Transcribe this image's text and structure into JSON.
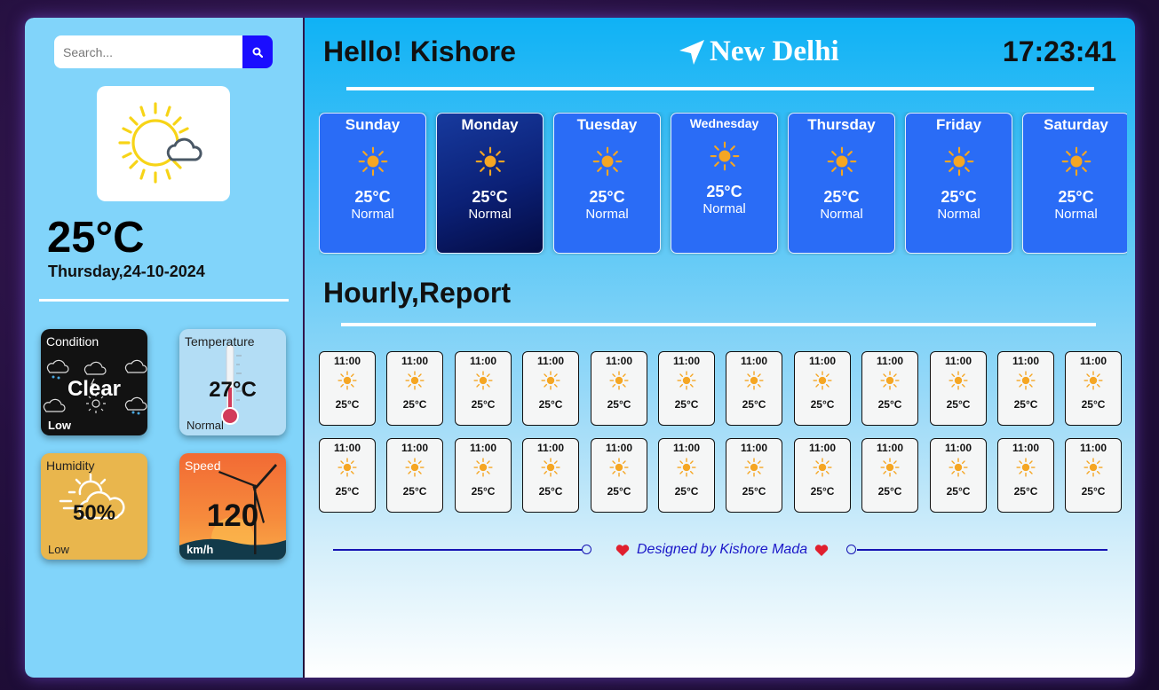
{
  "search": {
    "placeholder": "Search..."
  },
  "sidebar": {
    "temperature": "25°C",
    "date": "Thursday,24-10-2024",
    "tiles": {
      "condition": {
        "label": "Condition",
        "value": "Clear",
        "sub": "Low"
      },
      "temperature": {
        "label": "Temperature",
        "value": "27°C",
        "sub": "Normal"
      },
      "humidity": {
        "label": "Humidity",
        "value": "50%",
        "sub": "Low"
      },
      "speed": {
        "label": "Speed",
        "value": "120",
        "sub": "km/h"
      }
    }
  },
  "header": {
    "greeting": "Hello! Kishore",
    "city": "New Delhi",
    "time": "17:23:41"
  },
  "days": [
    {
      "name": "Sunday",
      "temp": "25°C",
      "cond": "Normal"
    },
    {
      "name": "Monday",
      "temp": "25°C",
      "cond": "Normal"
    },
    {
      "name": "Tuesday",
      "temp": "25°C",
      "cond": "Normal"
    },
    {
      "name": "Wednesday",
      "temp": "25°C",
      "cond": "Normal"
    },
    {
      "name": "Thursday",
      "temp": "25°C",
      "cond": "Normal"
    },
    {
      "name": "Friday",
      "temp": "25°C",
      "cond": "Normal"
    },
    {
      "name": "Saturday",
      "temp": "25°C",
      "cond": "Normal"
    }
  ],
  "hourly": {
    "title": "Hourly,Report",
    "rows": [
      [
        {
          "time": "11:00",
          "temp": "25°C"
        },
        {
          "time": "11:00",
          "temp": "25°C"
        },
        {
          "time": "11:00",
          "temp": "25°C"
        },
        {
          "time": "11:00",
          "temp": "25°C"
        },
        {
          "time": "11:00",
          "temp": "25°C"
        },
        {
          "time": "11:00",
          "temp": "25°C"
        },
        {
          "time": "11:00",
          "temp": "25°C"
        },
        {
          "time": "11:00",
          "temp": "25°C"
        },
        {
          "time": "11:00",
          "temp": "25°C"
        },
        {
          "time": "11:00",
          "temp": "25°C"
        },
        {
          "time": "11:00",
          "temp": "25°C"
        },
        {
          "time": "11:00",
          "temp": "25°C"
        }
      ],
      [
        {
          "time": "11:00",
          "temp": "25°C"
        },
        {
          "time": "11:00",
          "temp": "25°C"
        },
        {
          "time": "11:00",
          "temp": "25°C"
        },
        {
          "time": "11:00",
          "temp": "25°C"
        },
        {
          "time": "11:00",
          "temp": "25°C"
        },
        {
          "time": "11:00",
          "temp": "25°C"
        },
        {
          "time": "11:00",
          "temp": "25°C"
        },
        {
          "time": "11:00",
          "temp": "25°C"
        },
        {
          "time": "11:00",
          "temp": "25°C"
        },
        {
          "time": "11:00",
          "temp": "25°C"
        },
        {
          "time": "11:00",
          "temp": "25°C"
        },
        {
          "time": "11:00",
          "temp": "25°C"
        }
      ]
    ]
  },
  "footer": {
    "text": "Designed by Kishore Mada"
  },
  "colors": {
    "accent": "#1a0dff",
    "day_card": "#2a6cf6",
    "sidebar": "#81d4fa",
    "sun": "#f5a623"
  },
  "icons": {
    "search": "search-icon",
    "weather": "sun-cloud-icon",
    "location": "location-arrow-icon",
    "sun": "sun-icon",
    "heart": "heart-icon"
  }
}
